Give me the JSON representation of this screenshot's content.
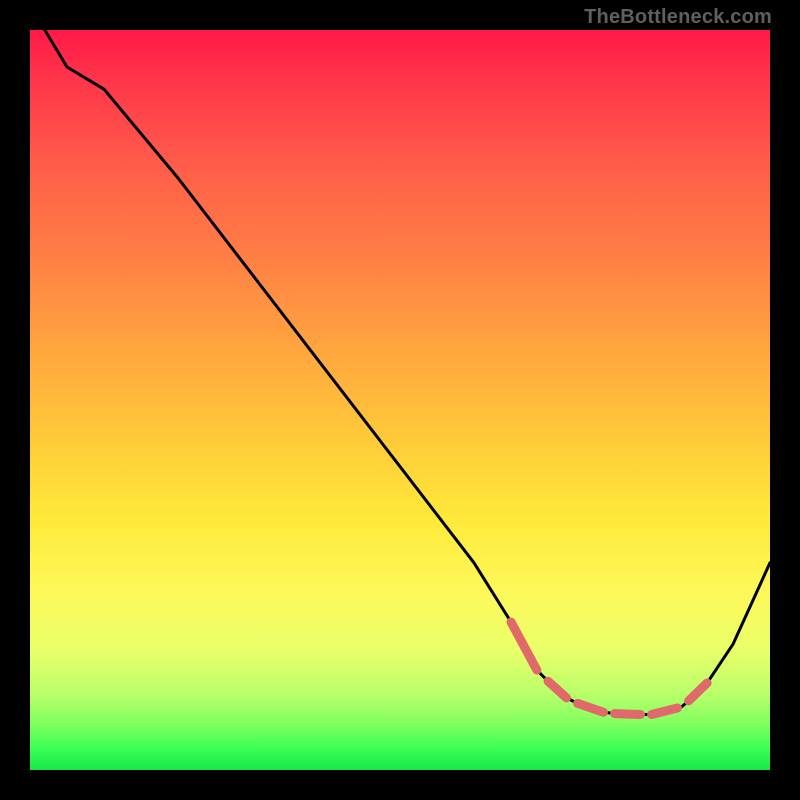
{
  "watermark": "TheBottleneck.com",
  "chart_data": {
    "type": "line",
    "title": "",
    "xlabel": "",
    "ylabel": "",
    "xlim": [
      0,
      100
    ],
    "ylim": [
      0,
      100
    ],
    "grid": false,
    "legend": false,
    "series": [
      {
        "name": "curve",
        "x": [
          2,
          5,
          10,
          20,
          30,
          40,
          50,
          60,
          65,
          68,
          72,
          76,
          80,
          84,
          88,
          91,
          95,
          100
        ],
        "y": [
          100,
          95,
          92,
          80,
          67,
          54,
          41,
          28,
          20,
          14,
          10,
          8,
          7.5,
          7.5,
          8.5,
          11,
          17,
          28
        ]
      }
    ],
    "dash_segments_x": [
      [
        65,
        68.5
      ],
      [
        70,
        72.5
      ],
      [
        74,
        77.5
      ],
      [
        79,
        82.5
      ],
      [
        84,
        87.5
      ],
      [
        89,
        91.5
      ]
    ]
  },
  "colors": {
    "curve": "#000000",
    "dash": "#e06a6a"
  }
}
